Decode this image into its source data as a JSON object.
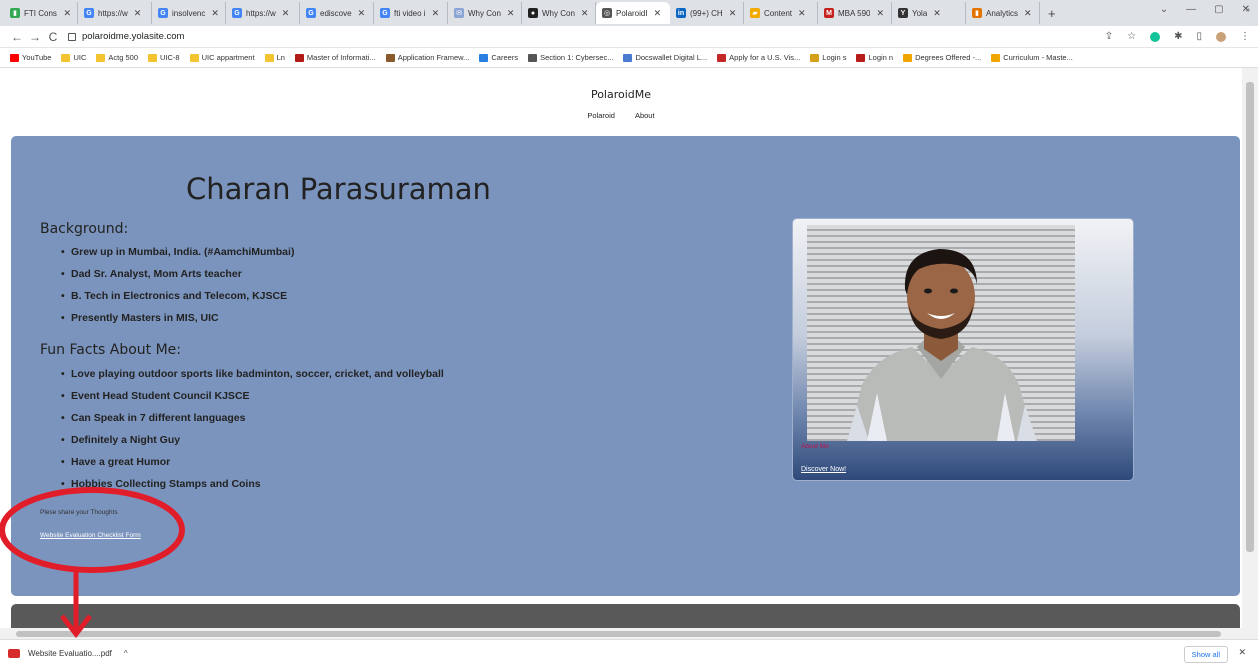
{
  "tabs": [
    {
      "title": "FTI Consu",
      "color": "#34a853",
      "glyph": "▮"
    },
    {
      "title": "https://w",
      "color": "#4285f4",
      "glyph": "G"
    },
    {
      "title": "insolvenc",
      "color": "#4285f4",
      "glyph": "G"
    },
    {
      "title": "https://w",
      "color": "#4285f4",
      "glyph": "G"
    },
    {
      "title": "ediscove",
      "color": "#4285f4",
      "glyph": "G"
    },
    {
      "title": "fti video i",
      "color": "#4285f4",
      "glyph": "G"
    },
    {
      "title": "Why Con",
      "color": "#8aa4d6",
      "glyph": "✉"
    },
    {
      "title": "Why Con",
      "color": "#222222",
      "glyph": "●"
    },
    {
      "title": "PolaroidI",
      "color": "#555555",
      "glyph": "◎",
      "active": true
    },
    {
      "title": "(99+) CH",
      "color": "#0a66c2",
      "glyph": "in"
    },
    {
      "title": "Content",
      "color": "#f2a900",
      "glyph": "▰"
    },
    {
      "title": "MBA 590",
      "color": "#c5221f",
      "glyph": "M"
    },
    {
      "title": "Yola",
      "color": "#333333",
      "glyph": "Y"
    },
    {
      "title": "Analytics",
      "color": "#e37400",
      "glyph": "▮"
    }
  ],
  "newtab": "+",
  "window_controls": {
    "minimize": "—",
    "restore": "▢",
    "close": "✕",
    "caret": "⌄"
  },
  "address": {
    "url": "polaroidme.yolasite.com"
  },
  "nav": {
    "back": "←",
    "forward": "→",
    "reload": "C"
  },
  "bookmarks": [
    {
      "label": "YouTube",
      "color": "#ff0000"
    },
    {
      "label": "UIC",
      "color": "#f4c430"
    },
    {
      "label": "Actg 500",
      "color": "#f4c430"
    },
    {
      "label": "UIC-8",
      "color": "#f4c430"
    },
    {
      "label": "UIC appartment",
      "color": "#f4c430"
    },
    {
      "label": "Ln",
      "color": "#f4c430"
    },
    {
      "label": "Master of Informati...",
      "color": "#b31b1b"
    },
    {
      "label": "Application Framew...",
      "color": "#8b5a2b"
    },
    {
      "label": "Careers",
      "color": "#2a7de1"
    },
    {
      "label": "Section 1: Cybersec...",
      "color": "#555555"
    },
    {
      "label": "Docswallet Digital L...",
      "color": "#4a7bd0"
    },
    {
      "label": "Apply for a U.S. Vis...",
      "color": "#c62828"
    },
    {
      "label": "Login s",
      "color": "#d4a017"
    },
    {
      "label": "Login n",
      "color": "#b71c1c"
    },
    {
      "label": "Degrees Offered -...",
      "color": "#f0a500"
    },
    {
      "label": "Curriculum - Maste...",
      "color": "#f0a500"
    }
  ],
  "bookmarks_more": "»",
  "site": {
    "title": "PolaroidMe",
    "nav": [
      "Polaroid",
      "About"
    ],
    "name": "Charan Parasuraman",
    "background_heading": "Background:",
    "background_items": [
      "Grew up in Mumbai, India. (#AamchiMumbai)",
      "Dad Sr. Analyst, Mom Arts teacher",
      "B. Tech in Electronics and Telecom, KJSCE",
      "Presently Masters in MIS, UIC"
    ],
    "funfacts_heading": "Fun Facts About Me:",
    "funfacts_items": [
      "Love playing outdoor sports like badminton, soccer, cricket, and volleyball",
      "Event Head Student Council KJSCE",
      "Can Speak in 7 different languages",
      "Definitely a Night Guy",
      "Have a great Humor",
      "Hobbies Collecting Stamps and Coins"
    ],
    "share_text": "Plese share your Thoughts",
    "form_link": "Website Evaluation Checklist Form",
    "card_about": "About Me",
    "card_link": "Discover Now!"
  },
  "download": {
    "filename": "Website Evaluatio....pdf",
    "caret": "^",
    "show_all": "Show all",
    "close": "✕"
  },
  "colors": {
    "hero": "#7b94bd",
    "annotation": "#e11d2a",
    "footer": "#595959"
  }
}
